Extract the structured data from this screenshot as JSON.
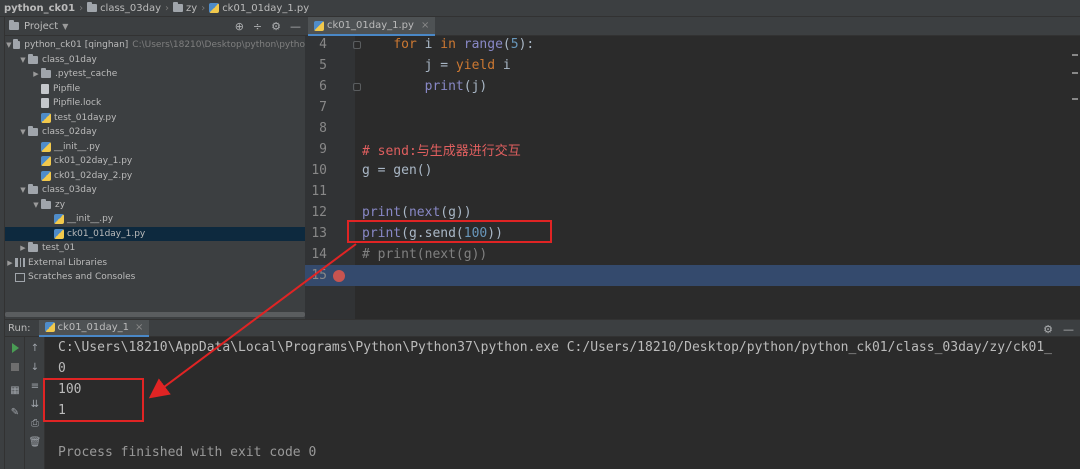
{
  "breadcrumb": [
    "python_ck01",
    "class_03day",
    "zy",
    "ck01_01day_1.py"
  ],
  "project_panel": {
    "title": "Project",
    "tree": [
      {
        "label": "python_ck01 [qinghan]",
        "extra": "C:\\Users\\18210\\Desktop\\python\\pytho",
        "type": "folder",
        "depth": 0,
        "expanded": true
      },
      {
        "label": "class_01day",
        "type": "folder",
        "depth": 1,
        "expanded": true
      },
      {
        "label": ".pytest_cache",
        "type": "folder",
        "depth": 2,
        "expanded": false
      },
      {
        "label": "Pipfile",
        "type": "file",
        "depth": 2
      },
      {
        "label": "Pipfile.lock",
        "type": "file",
        "depth": 2
      },
      {
        "label": "test_01day.py",
        "type": "py",
        "depth": 2
      },
      {
        "label": "class_02day",
        "type": "folder",
        "depth": 1,
        "expanded": true
      },
      {
        "label": "__init__.py",
        "type": "py",
        "depth": 2
      },
      {
        "label": "ck01_02day_1.py",
        "type": "py",
        "depth": 2
      },
      {
        "label": "ck01_02day_2.py",
        "type": "py",
        "depth": 2
      },
      {
        "label": "class_03day",
        "type": "folder",
        "depth": 1,
        "expanded": true
      },
      {
        "label": "zy",
        "type": "folder",
        "depth": 2,
        "expanded": true
      },
      {
        "label": "__init__.py",
        "type": "py",
        "depth": 3
      },
      {
        "label": "ck01_01day_1.py",
        "type": "py",
        "depth": 3,
        "selected": true
      },
      {
        "label": "test_01",
        "type": "folder",
        "depth": 1,
        "expanded": false
      },
      {
        "label": "External Libraries",
        "type": "lib",
        "depth": 0,
        "expanded": false
      },
      {
        "label": "Scratches and Consoles",
        "type": "scratch",
        "depth": 0
      }
    ]
  },
  "editor": {
    "tab_label": "ck01_01day_1.py",
    "lines": [
      {
        "n": "4",
        "tokens": [
          {
            "t": "    "
          },
          {
            "t": "for",
            "c": "kw"
          },
          {
            "t": " i "
          },
          {
            "t": "in",
            "c": "kw"
          },
          {
            "t": " "
          },
          {
            "t": "range",
            "c": "fn"
          },
          {
            "t": "("
          },
          {
            "t": "5",
            "c": "num"
          },
          {
            "t": "):"
          }
        ]
      },
      {
        "n": "5",
        "tokens": [
          {
            "t": "        j = "
          },
          {
            "t": "yield",
            "c": "kw"
          },
          {
            "t": " i"
          }
        ]
      },
      {
        "n": "6",
        "tokens": [
          {
            "t": "        "
          },
          {
            "t": "print",
            "c": "fn"
          },
          {
            "t": "(j)"
          }
        ]
      },
      {
        "n": "7",
        "tokens": []
      },
      {
        "n": "8",
        "tokens": []
      },
      {
        "n": "9",
        "tokens": [
          {
            "t": "# send:与生成器进行交互",
            "c": "cmt-red"
          }
        ]
      },
      {
        "n": "10",
        "tokens": [
          {
            "t": "g = gen()"
          }
        ]
      },
      {
        "n": "11",
        "tokens": []
      },
      {
        "n": "12",
        "tokens": [
          {
            "t": "print",
            "c": "fn"
          },
          {
            "t": "("
          },
          {
            "t": "next",
            "c": "fn"
          },
          {
            "t": "(g))"
          }
        ]
      },
      {
        "n": "13",
        "tokens": [
          {
            "t": "print",
            "c": "fn"
          },
          {
            "t": "(g.send("
          },
          {
            "t": "100",
            "c": "num"
          },
          {
            "t": "))"
          }
        ]
      },
      {
        "n": "14",
        "tokens": [
          {
            "t": "# print(next(g))",
            "c": "cmt"
          }
        ]
      },
      {
        "n": "15",
        "tokens": [],
        "current": true,
        "breakpoint": true
      }
    ]
  },
  "run_panel": {
    "label": "Run:",
    "tab_label": "ck01_01day_1",
    "output": [
      {
        "text": "C:\\Users\\18210\\AppData\\Local\\Programs\\Python\\Python37\\python.exe C:/Users/18210/Desktop/python/python_ck01/class_03day/zy/ck01_",
        "style": "cmd"
      },
      {
        "text": "0",
        "style": "normal"
      },
      {
        "text": "100",
        "style": "normal"
      },
      {
        "text": "1",
        "style": "normal"
      },
      {
        "text": "",
        "style": "normal"
      },
      {
        "text": "Process finished with exit code 0",
        "style": "gray"
      }
    ]
  },
  "colors": {
    "annotation": "#e02424",
    "accent": "#4a88c7",
    "current_line": "#344a6d"
  }
}
